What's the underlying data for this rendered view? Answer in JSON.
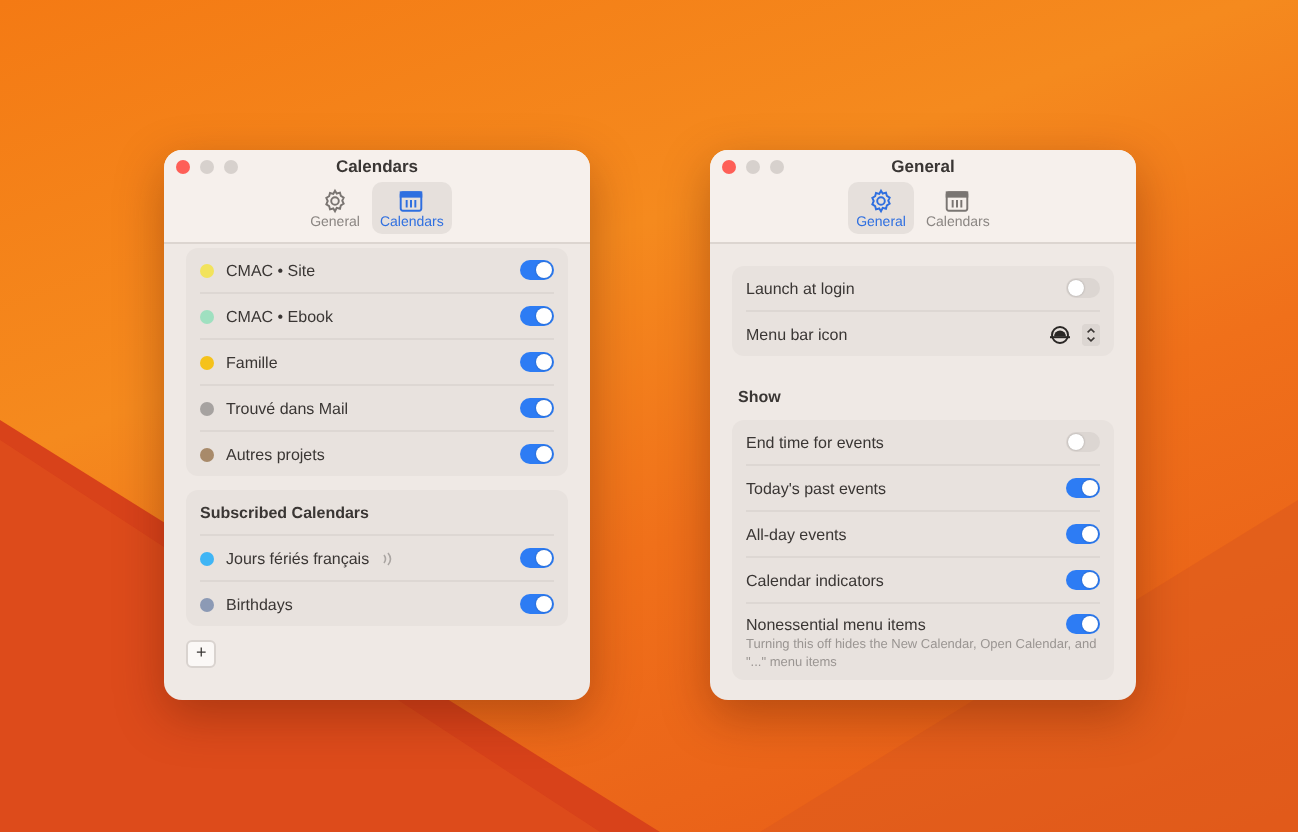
{
  "windows": [
    {
      "title": "Calendars",
      "tabs": [
        {
          "label": "General",
          "kind": "gear",
          "selected": false
        },
        {
          "label": "Calendars",
          "kind": "calendar",
          "selected": true
        }
      ],
      "groups": [
        {
          "rows": [
            {
              "kind": "calendar",
              "label": "CMAC • Site",
              "color": "#f2e35c",
              "on": true
            },
            {
              "kind": "calendar",
              "label": "CMAC • Ebook",
              "color": "#9fe0c0",
              "on": true
            },
            {
              "kind": "calendar",
              "label": "Famille",
              "color": "#f5c21b",
              "on": true
            },
            {
              "kind": "calendar",
              "label": "Trouvé dans Mail",
              "color": "#a6a2a0",
              "on": true
            },
            {
              "kind": "calendar",
              "label": "Autres projets",
              "color": "#a88a6a",
              "on": true
            }
          ]
        },
        {
          "header": "Subscribed Calendars",
          "rows": [
            {
              "kind": "feed-calendar",
              "label": "Jours fériés français",
              "color": "#3fb5f5",
              "on": true
            },
            {
              "kind": "calendar",
              "label": "Birthdays",
              "color": "#8c9ab5",
              "on": true
            }
          ]
        }
      ],
      "add_button": "+"
    },
    {
      "title": "General",
      "tabs": [
        {
          "label": "General",
          "kind": "gear",
          "selected": true
        },
        {
          "label": "Calendars",
          "kind": "calendar",
          "selected": false
        }
      ],
      "groups": [
        {
          "rows": [
            {
              "kind": "toggle",
              "label": "Launch at login",
              "on": false
            },
            {
              "kind": "picker",
              "label": "Menu bar icon"
            }
          ]
        },
        {
          "header": "Show",
          "rows": [
            {
              "kind": "toggle",
              "label": "End time for events",
              "on": false
            },
            {
              "kind": "toggle",
              "label": "Today's past events",
              "on": true
            },
            {
              "kind": "toggle",
              "label": "All-day events",
              "on": true
            },
            {
              "kind": "toggle",
              "label": "Calendar indicators",
              "on": true
            },
            {
              "kind": "toggle",
              "label": "Nonessential menu items",
              "on": true,
              "description": "Turning this off hides the New Calendar, Open Calendar, and \"...\" menu items"
            }
          ]
        }
      ]
    }
  ]
}
